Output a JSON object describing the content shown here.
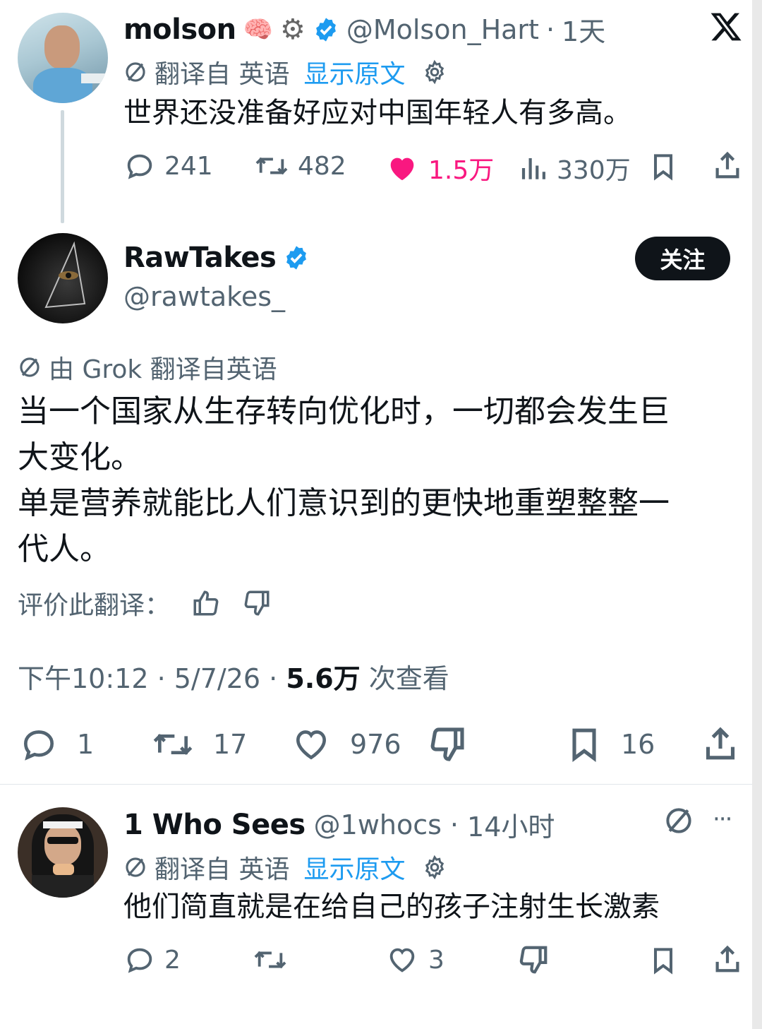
{
  "top_tweet": {
    "display_name": "molson",
    "emojis": "🧠⚙️",
    "handle": "@Molson_Hart",
    "dot": "·",
    "time": "1天",
    "translated_label": "翻译自 英语",
    "show_original": "显示原文",
    "text": "世界还没准备好应对中国年轻人有多高。",
    "replies": "241",
    "retweets": "482",
    "likes": "1.5万",
    "views": "330万"
  },
  "main_tweet": {
    "display_name": "RawTakes",
    "handle": "@rawtakes_",
    "follow_label": "关注",
    "grok_label": "由 Grok 翻译自英语",
    "line1": "当一个国家从生存转向优化时，一切都会发生巨",
    "line2": "大变化。",
    "line3": "单是营养就能比人们意识到的更快地重塑整整一",
    "line4": "代人。",
    "rate_label": "评价此翻译：",
    "timestamp": "下午10:12 · 5/7/26 · ",
    "views_count": "5.6万",
    "views_label": " 次查看",
    "replies": "1",
    "retweets": "17",
    "likes": "976",
    "bookmarks": "16"
  },
  "reply_tweet": {
    "display_name": "1 Who Sees",
    "handle": "@1whocs",
    "dot": "·",
    "time": "14小时",
    "translated_label": "翻译自 英语",
    "show_original": "显示原文",
    "text": "他们简直就是在给自己的孩子注射生长激素",
    "replies": "2",
    "likes": "3",
    "more": "···"
  },
  "colors": {
    "like_active": "#f91880",
    "link_blue": "#1d9bf0",
    "muted": "#536471",
    "verified": "#1d9bf0"
  }
}
